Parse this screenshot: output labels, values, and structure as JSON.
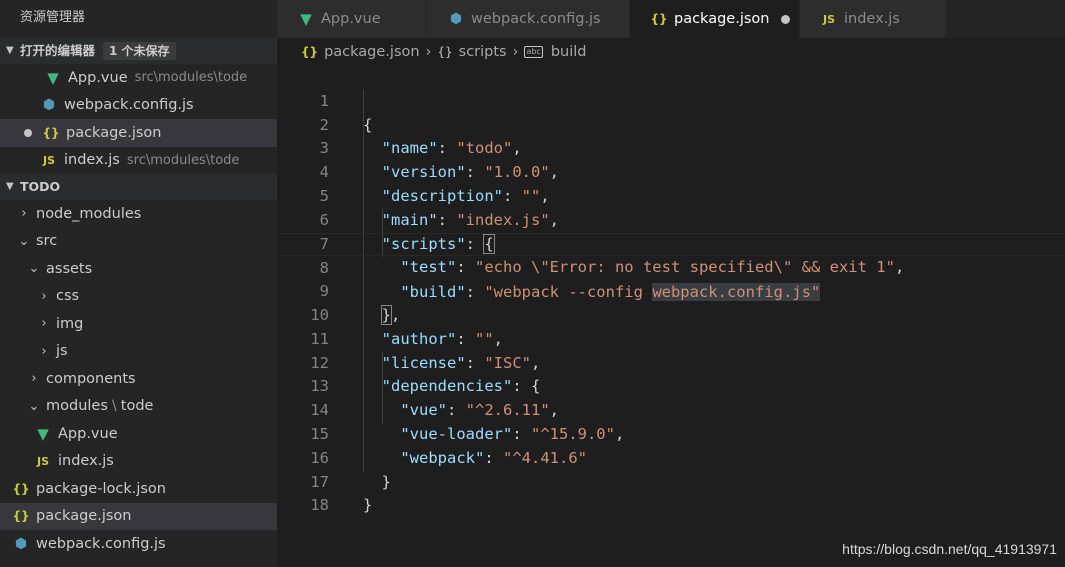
{
  "explorer": {
    "title": "资源管理器",
    "open_editors_header": "打开的编辑器",
    "unsaved_badge": "1 个未保存",
    "open_editors": [
      {
        "name": "App.vue",
        "path": "src\\modules\\tode",
        "icon": "vue-icon"
      },
      {
        "name": "webpack.config.js",
        "path": "",
        "icon": "webpack-icon"
      },
      {
        "name": "package.json",
        "path": "",
        "icon": "json-icon"
      },
      {
        "name": "index.js",
        "path": "src\\modules\\tode",
        "icon": "js-icon"
      }
    ],
    "project_header": "TODO",
    "tree": {
      "node_modules": "node_modules",
      "src": "src",
      "assets": "assets",
      "css": "css",
      "img": "img",
      "js": "js",
      "components": "components",
      "modules": "modules",
      "tode": "tode",
      "app_vue": "App.vue",
      "index_js": "index.js",
      "package_lock": "package-lock.json",
      "package_json": "package.json",
      "webpack_config": "webpack.config.js"
    }
  },
  "tabs": [
    {
      "label": "App.vue",
      "icon": "vue-icon"
    },
    {
      "label": "webpack.config.js",
      "icon": "webpack-icon"
    },
    {
      "label": "package.json",
      "icon": "json-icon",
      "active": true,
      "dirty": true
    },
    {
      "label": "index.js",
      "icon": "js-icon"
    }
  ],
  "breadcrumb": {
    "file": "package.json",
    "section": "scripts",
    "item": "build"
  },
  "editor": {
    "line_numbers": [
      "1",
      "2",
      "3",
      "4",
      "5",
      "6",
      "7",
      "8",
      "9",
      "10",
      "11",
      "12",
      "13",
      "14",
      "15",
      "16",
      "17",
      "18"
    ],
    "code": {
      "l1": "{",
      "name_key": "\"name\"",
      "name_val": "\"todo\"",
      "version_key": "\"version\"",
      "version_val": "\"1.0.0\"",
      "description_key": "\"description\"",
      "description_val": "\"\"",
      "main_key": "\"main\"",
      "main_val": "\"index.js\"",
      "scripts_key": "\"scripts\"",
      "scripts_open": "{",
      "test_key": "\"test\"",
      "test_val": "\"echo \\\"Error: no test specified\\\" && exit 1\"",
      "build_key": "\"build\"",
      "build_val_a": "\"webpack --config ",
      "build_val_b": "webpack.config.js",
      "build_val_c": "\"",
      "scripts_close": "}",
      "author_key": "\"author\"",
      "author_val": "\"\"",
      "license_key": "\"license\"",
      "license_val": "\"ISC\"",
      "deps_key": "\"dependencies\"",
      "deps_open": "{",
      "vue_key": "\"vue\"",
      "vue_val": "\"^2.6.11\"",
      "vueloader_key": "\"vue-loader\"",
      "vueloader_val": "\"^15.9.0\"",
      "webpack_key": "\"webpack\"",
      "webpack_val": "\"^4.41.6\"",
      "deps_close": "}",
      "l17": "}"
    }
  },
  "watermark": "https://blog.csdn.net/qq_41913971"
}
